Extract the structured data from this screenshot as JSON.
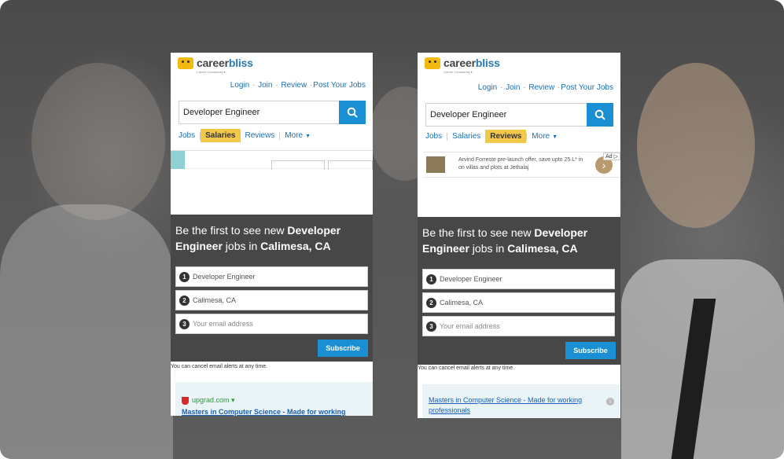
{
  "left_phone": {
    "logo": {
      "brand_a": "career",
      "brand_b": "bliss",
      "tagline": "Career Community ▾"
    },
    "toplinks": [
      "Login",
      "Join",
      "Review",
      "Post Your Jobs"
    ],
    "search": {
      "value": "Developer Engineer"
    },
    "tabs": [
      "Jobs",
      "Salaries",
      "Reviews",
      "More"
    ],
    "active_tab": "Salaries",
    "alert": {
      "line_prefix": "Be the first to see new ",
      "job": "Developer Engineer",
      "mid": " jobs in ",
      "location": "Calimesa, CA"
    },
    "fields": [
      {
        "num": "1",
        "value": "Developer Engineer"
      },
      {
        "num": "2",
        "value": "Calimesa, CA"
      },
      {
        "num": "3",
        "placeholder": "Your email address"
      }
    ],
    "subscribe_label": "Subscribe",
    "cancel_note": "You can cancel email alerts at any time.",
    "promo": {
      "source": "upgrad.com ▾",
      "link": "Masters in Computer Science - Made for working"
    }
  },
  "right_phone": {
    "logo": {
      "brand_a": "career",
      "brand_b": "bliss",
      "tagline": "Career Community ▾"
    },
    "toplinks": [
      "Login",
      "Join",
      "Review",
      "Post Your Jobs"
    ],
    "search": {
      "value": "Developer Engineer"
    },
    "tabs": [
      "Jobs",
      "Salaries",
      "Reviews",
      "More"
    ],
    "active_tab": "Reviews",
    "ad": {
      "text": "Arvind Forreste pre-launch offer, save upto 25 L* in on villas and plots at Jethalaj",
      "badge": "Ad ▷"
    },
    "alert": {
      "line_prefix": "Be the first to see new ",
      "job": "Developer Engineer",
      "mid": " jobs in ",
      "location": "Calimesa, CA"
    },
    "fields": [
      {
        "num": "1",
        "value": "Developer Engineer"
      },
      {
        "num": "2",
        "value": "Calimesa, CA"
      },
      {
        "num": "3",
        "placeholder": "Your email address"
      }
    ],
    "subscribe_label": "Subscribe",
    "cancel_note": "You can cancel email alerts at any time.",
    "promo": {
      "link": "Masters in Computer Science - Made for working professionals"
    }
  },
  "colors": {
    "accent": "#1a8fd4",
    "tab_active": "#f2c84b",
    "alert_bg": "#474747",
    "link": "#1a6fb0"
  }
}
